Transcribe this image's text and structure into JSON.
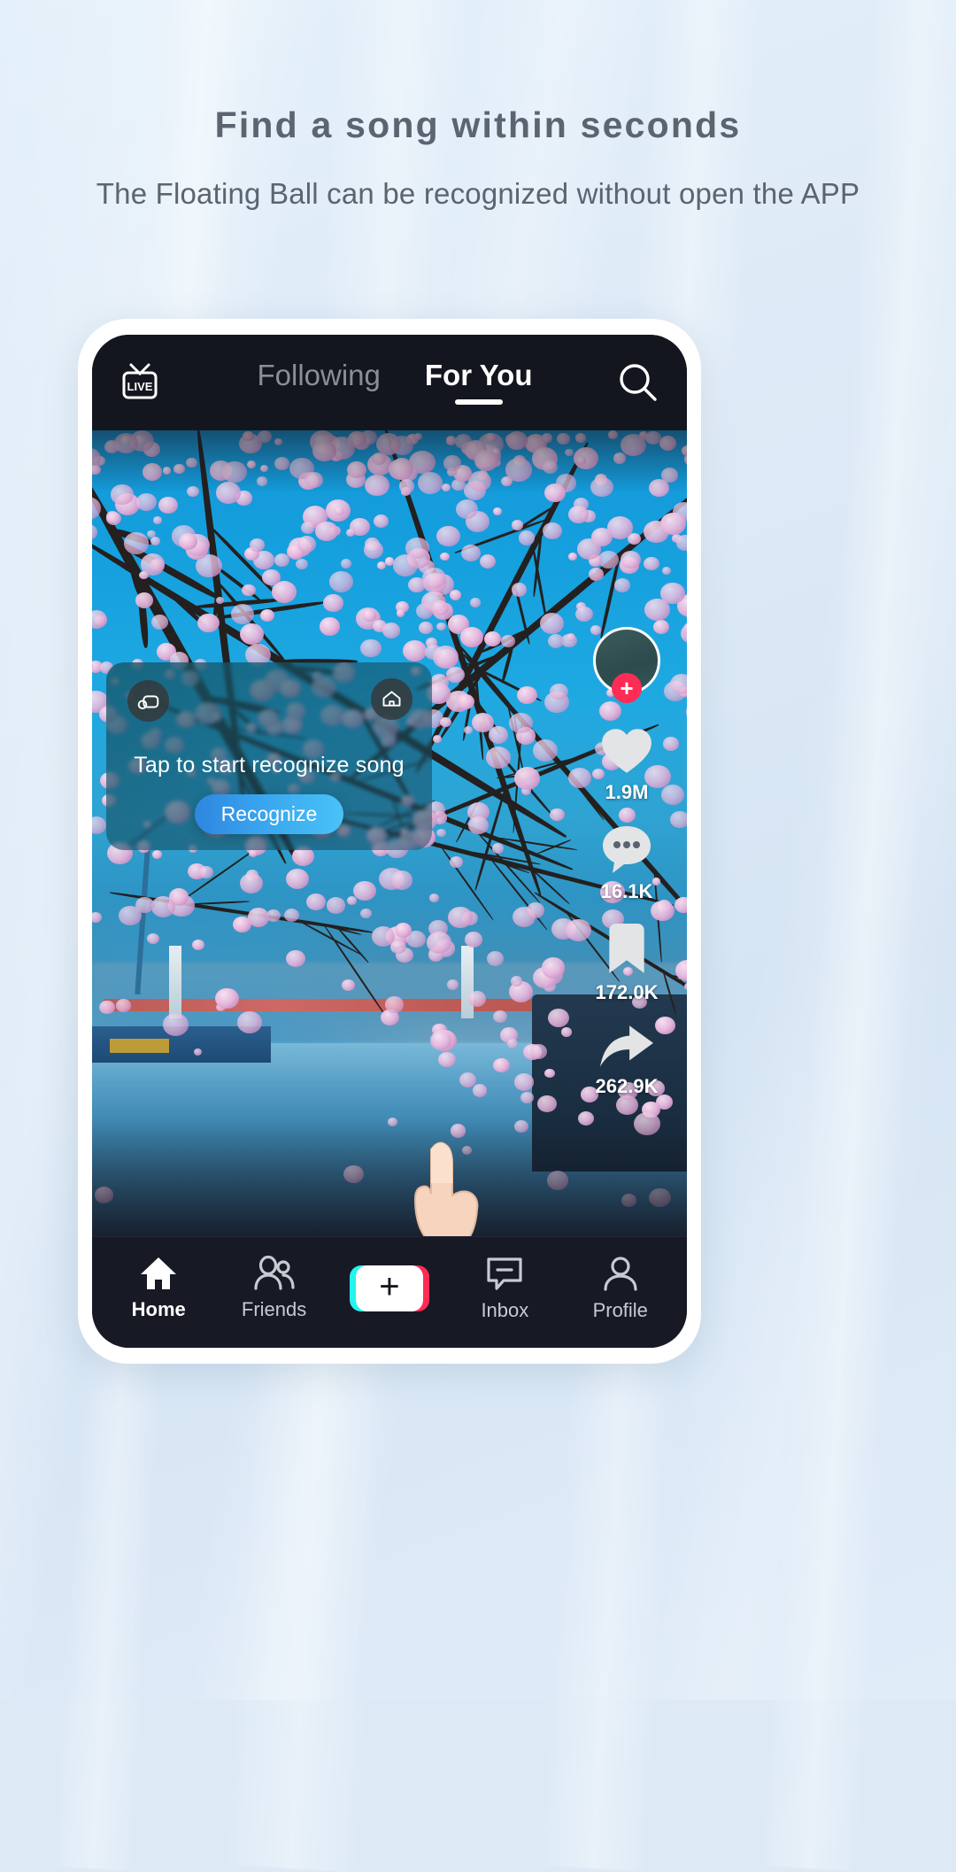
{
  "page": {
    "title": "Find a song within seconds",
    "subtitle": "The Floating Ball can be recognized without open the APP",
    "bg_color": "#dce9f6"
  },
  "phone": {
    "topnav": {
      "live_label": "LIVE",
      "tabs": [
        {
          "label": "Following",
          "active": false
        },
        {
          "label": "For You",
          "active": true
        }
      ],
      "search_icon": "search-icon"
    },
    "overlay_card": {
      "left_icon": "minimize-bubble-icon",
      "right_icon": "home-icon",
      "message": "Tap to start recognize song",
      "button_label": "Recognize",
      "button_color": "#39a5ef",
      "cursor": "pointing-hand-cursor"
    },
    "rail": {
      "avatar": "creator-avatar",
      "follow_label": "+",
      "follow_color": "#fe2c55",
      "actions": [
        {
          "icon": "heart-icon",
          "count": "1.9M"
        },
        {
          "icon": "comment-icon",
          "count": "16.1K"
        },
        {
          "icon": "bookmark-icon",
          "count": "172.0K"
        },
        {
          "icon": "share-icon",
          "count": "262.9K"
        }
      ]
    },
    "tabbar": {
      "items": [
        {
          "label": "Home",
          "icon": "home-icon",
          "active": true
        },
        {
          "label": "Friends",
          "icon": "friends-icon",
          "active": false
        },
        {
          "label": "Inbox",
          "icon": "inbox-icon",
          "active": false
        },
        {
          "label": "Profile",
          "icon": "profile-icon",
          "active": false
        }
      ],
      "create": {
        "icon": "plus-icon",
        "label": "+",
        "accent_left": "#25f4ee",
        "accent_right": "#fe2c55"
      }
    }
  }
}
